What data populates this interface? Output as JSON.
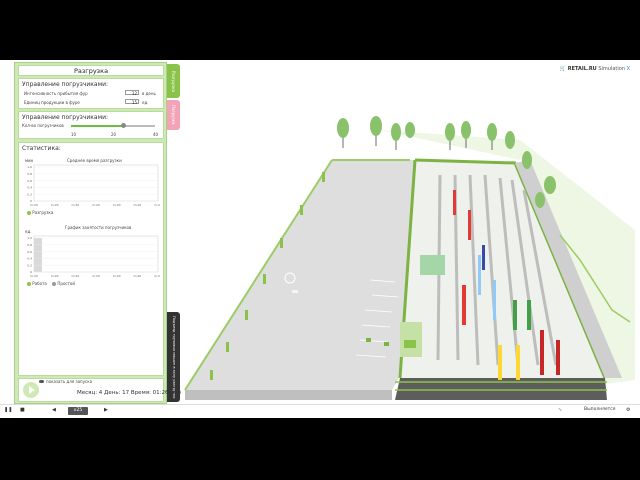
{
  "panel": {
    "title": "Разгрузка",
    "section1_header": "Управление погрузчиками:",
    "arrival_label": "Интенсивность прибытия фур",
    "arrival_value": "12",
    "arrival_unit": "в день",
    "units_label": "Единиц продукции в фуре",
    "units_value": "15",
    "units_unit": "ед.",
    "section2_header": "Управление погрузчиками:",
    "count_label": "Кол-во погрузчиков",
    "slider_level": 0.62,
    "slider_ticks": [
      "10",
      "20",
      "40"
    ],
    "stats_header": "Статистика:",
    "chart1_title": "Среднее время разгрузки",
    "chart1_yticks": [
      "1,0",
      "0,8",
      "0,6",
      "0,4",
      "0,2",
      "0"
    ],
    "chart1_ylabel": "мин",
    "chart1_xticks": [
      "m:20",
      "m:20",
      "m:20",
      "m:20",
      "m:20",
      "m:20",
      "m:20"
    ],
    "chart1_legend": "Разгрузка",
    "chart2_title": "График занятости погрузчиков",
    "chart2_ylabel": "ед.",
    "chart2_yticks": [
      "1,0",
      "0,8",
      "0,6",
      "0,4",
      "0,2",
      "0"
    ],
    "chart2_xticks": [
      "m:20",
      "m:20",
      "m:20",
      "m:20",
      "m:20",
      "m:20",
      "m:20"
    ],
    "chart2_legend_busy": "Работа",
    "chart2_legend_idle": "Простой",
    "bottom_label": "показать для запуска",
    "status": "Месяц: 4 День: 17 Время: 01:26 (вт)"
  },
  "tabs": {
    "tab1": "Разгрузка",
    "tab2": "Погрузка",
    "tab3": "Подъезд грузовых машин в зону разгрузки"
  },
  "logo": {
    "brand": "RETAIL.RU",
    "product": "Simulation",
    "x": "X"
  },
  "bottombar": {
    "speed": "x25",
    "status": "Выполняется"
  },
  "colors": {
    "panel_green": "#cfe9b4",
    "accent_green": "#6cbf3d",
    "tab_pink": "#f3a3b8",
    "chart_green": "#8dc63f"
  }
}
